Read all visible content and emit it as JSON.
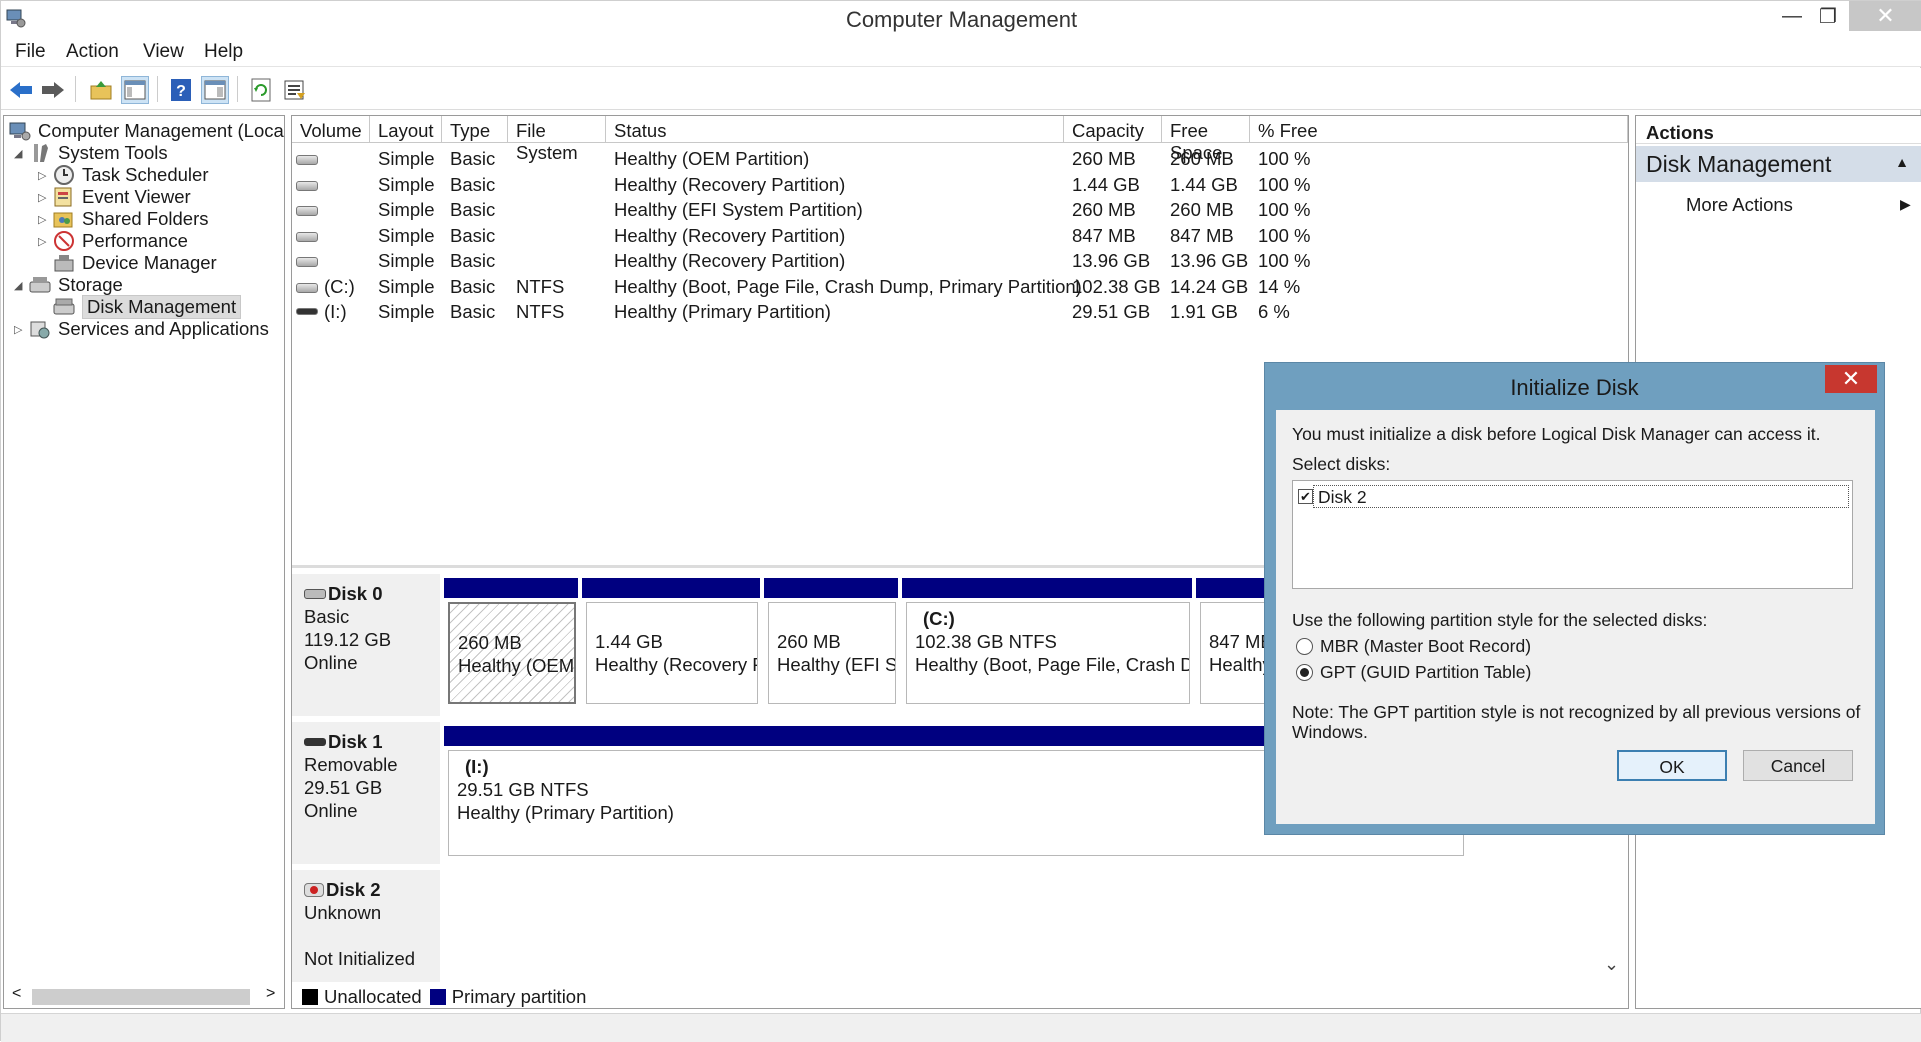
{
  "window": {
    "title": "Computer Management",
    "minimize": "—",
    "restore": "❐",
    "close": "✕"
  },
  "menu": [
    "File",
    "Action",
    "View",
    "Help"
  ],
  "toolbar": [
    "back-icon",
    "forward-icon",
    "up-folder-icon",
    "show-hide-tree-icon",
    "help-icon",
    "properties-icon",
    "refresh-icon",
    "export-list-icon"
  ],
  "tree": {
    "root": "Computer Management (Local",
    "system_tools": "System Tools",
    "task_scheduler": "Task Scheduler",
    "event_viewer": "Event Viewer",
    "shared_folders": "Shared Folders",
    "performance": "Performance",
    "device_manager": "Device Manager",
    "storage": "Storage",
    "disk_management": "Disk Management",
    "services": "Services and Applications",
    "scroll_left": "<",
    "scroll_right": ">"
  },
  "volumes": {
    "columns": [
      "Volume",
      "Layout",
      "Type",
      "File System",
      "Status",
      "Capacity",
      "Free Space",
      "% Free"
    ],
    "rows": [
      [
        "",
        "Simple",
        "Basic",
        "",
        "Healthy (OEM Partition)",
        "260 MB",
        "260 MB",
        "100 %"
      ],
      [
        "",
        "Simple",
        "Basic",
        "",
        "Healthy (Recovery Partition)",
        "1.44 GB",
        "1.44 GB",
        "100 %"
      ],
      [
        "",
        "Simple",
        "Basic",
        "",
        "Healthy (EFI System Partition)",
        "260 MB",
        "260 MB",
        "100 %"
      ],
      [
        "",
        "Simple",
        "Basic",
        "",
        "Healthy (Recovery Partition)",
        "847 MB",
        "847 MB",
        "100 %"
      ],
      [
        "",
        "Simple",
        "Basic",
        "",
        "Healthy (Recovery Partition)",
        "13.96 GB",
        "13.96 GB",
        "100 %"
      ],
      [
        "(C:)",
        "Simple",
        "Basic",
        "NTFS",
        "Healthy (Boot, Page File, Crash Dump, Primary Partition)",
        "102.38 GB",
        "14.24 GB",
        "14 %"
      ],
      [
        "(I:)",
        "Simple",
        "Basic",
        "NTFS",
        "Healthy (Primary Partition)",
        "29.51 GB",
        "1.91 GB",
        "6 %"
      ]
    ]
  },
  "disks": {
    "disk0": {
      "name": "Disk 0",
      "type": "Basic",
      "size": "119.12 GB",
      "state": "Online",
      "parts": [
        {
          "label": "",
          "size": "260 MB",
          "status": "Healthy (OEM"
        },
        {
          "label": "",
          "size": "1.44 GB",
          "status": "Healthy (Recovery P"
        },
        {
          "label": "",
          "size": "260 MB",
          "status": "Healthy (EFI Sy"
        },
        {
          "label": "(C:)",
          "size": "102.38 GB NTFS",
          "status": "Healthy (Boot, Page File, Crash Du"
        },
        {
          "label": "",
          "size": "847 MB",
          "status": "Healthy"
        }
      ]
    },
    "disk1": {
      "name": "Disk 1",
      "type": "Removable",
      "size": "29.51 GB",
      "state": "Online",
      "part": {
        "label": "(I:)",
        "size": "29.51 GB NTFS",
        "status": "Healthy (Primary Partition)"
      }
    },
    "disk2": {
      "name": "Disk 2",
      "type": "Unknown",
      "state": "Not Initialized"
    }
  },
  "legend": {
    "unallocated": "Unallocated",
    "primary": "Primary partition",
    "scroll_down": "⌄"
  },
  "actions": {
    "header": "Actions",
    "section": "Disk Management",
    "more": "More Actions"
  },
  "dialog": {
    "title": "Initialize Disk",
    "close": "✕",
    "intro": "You must initialize a disk before Logical Disk Manager can access it.",
    "select_label": "Select disks:",
    "disk_item": "Disk 2",
    "style_label": "Use the following partition style for the selected disks:",
    "mbr": "MBR (Master Boot Record)",
    "gpt": "GPT (GUID Partition Table)",
    "note1": "Note: The GPT partition style is not recognized by all previous versions of",
    "note2": "Windows.",
    "ok": "OK",
    "cancel": "Cancel"
  },
  "colors": {
    "primary_partition": "#000080",
    "unallocated": "#000000",
    "dialog_frame": "#6f9fbf",
    "close_red": "#c7372f"
  }
}
